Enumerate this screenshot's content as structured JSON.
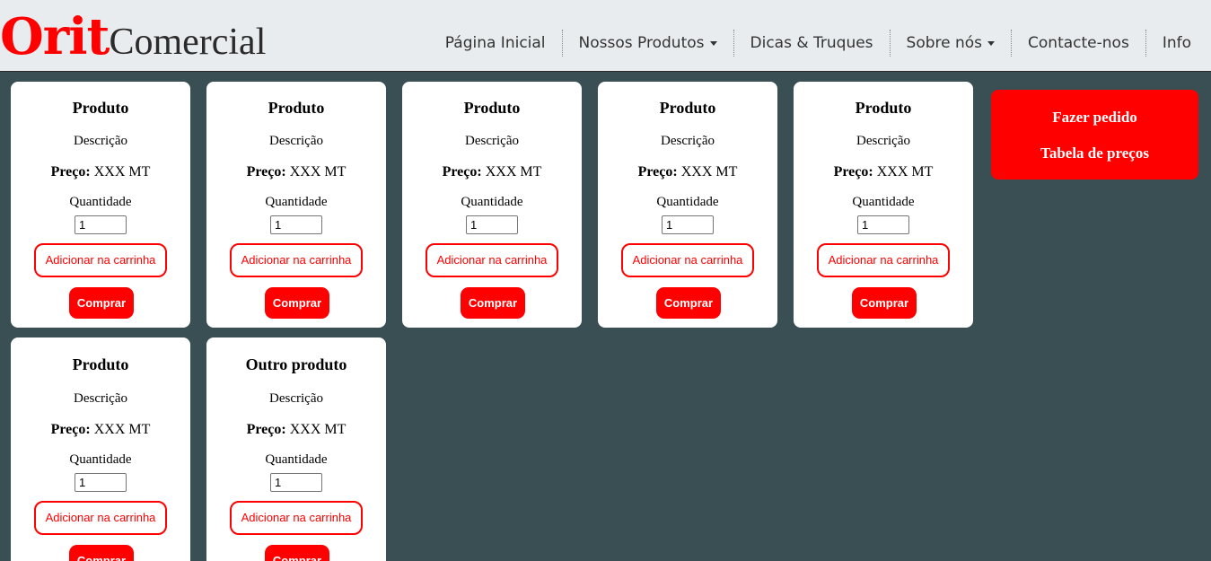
{
  "brand": {
    "orit": "Orit",
    "comercial": "Comercial"
  },
  "nav": {
    "items": [
      {
        "label": "Página Inicial",
        "dropdown": false
      },
      {
        "label": "Nossos Produtos",
        "dropdown": true
      },
      {
        "label": "Dicas & Truques",
        "dropdown": false
      },
      {
        "label": "Sobre nós",
        "dropdown": true
      },
      {
        "label": "Contacte-nos",
        "dropdown": false
      },
      {
        "label": "Info",
        "dropdown": false
      }
    ]
  },
  "products": [
    {
      "title": "Produto",
      "description": "Descrição",
      "price_label": "Preço:",
      "price_value": "XXX MT",
      "quantity_label": "Quantidade",
      "quantity": "1",
      "add_cart_label": "Adicionar na carrinha",
      "buy_label": "Comprar"
    },
    {
      "title": "Produto",
      "description": "Descrição",
      "price_label": "Preço:",
      "price_value": "XXX MT",
      "quantity_label": "Quantidade",
      "quantity": "1",
      "add_cart_label": "Adicionar na carrinha",
      "buy_label": "Comprar"
    },
    {
      "title": "Produto",
      "description": "Descrição",
      "price_label": "Preço:",
      "price_value": "XXX MT",
      "quantity_label": "Quantidade",
      "quantity": "1",
      "add_cart_label": "Adicionar na carrinha",
      "buy_label": "Comprar"
    },
    {
      "title": "Produto",
      "description": "Descrição",
      "price_label": "Preço:",
      "price_value": "XXX MT",
      "quantity_label": "Quantidade",
      "quantity": "1",
      "add_cart_label": "Adicionar na carrinha",
      "buy_label": "Comprar"
    },
    {
      "title": "Produto",
      "description": "Descrição",
      "price_label": "Preço:",
      "price_value": "XXX MT",
      "quantity_label": "Quantidade",
      "quantity": "1",
      "add_cart_label": "Adicionar na carrinha",
      "buy_label": "Comprar"
    },
    {
      "title": "Produto",
      "description": "Descrição",
      "price_label": "Preço:",
      "price_value": "XXX MT",
      "quantity_label": "Quantidade",
      "quantity": "1",
      "add_cart_label": "Adicionar na carrinha",
      "buy_label": "Comprar"
    },
    {
      "title": "Outro produto",
      "description": "Descrição",
      "price_label": "Preço:",
      "price_value": "XXX MT",
      "quantity_label": "Quantidade",
      "quantity": "1",
      "add_cart_label": "Adicionar na carrinha",
      "buy_label": "Comprar"
    }
  ],
  "side_panel": {
    "order_label": "Fazer pedido",
    "price_table_label": "Tabela de preços"
  },
  "colors": {
    "accent": "#ff0000",
    "background": "#394f53",
    "navbar": "#e9ecef",
    "card": "#ffffff"
  }
}
